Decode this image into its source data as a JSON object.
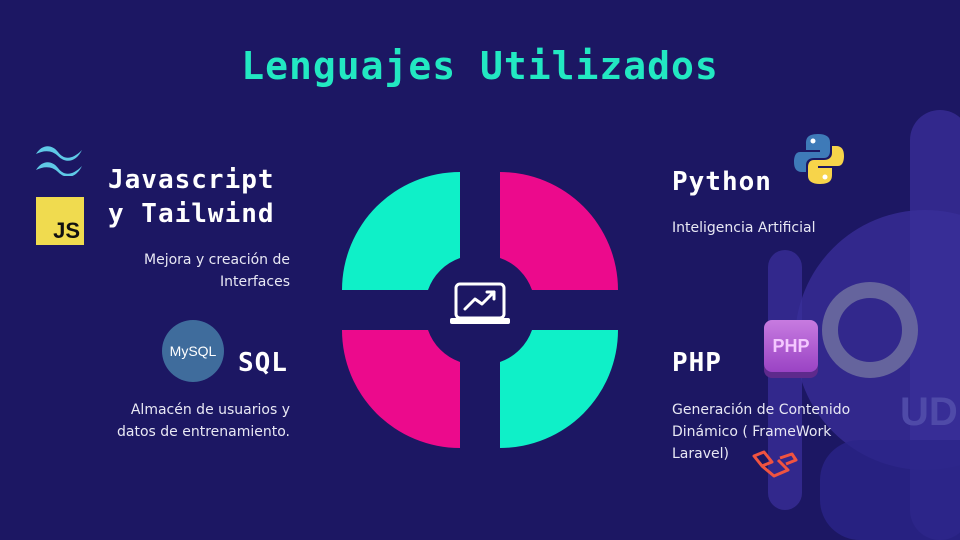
{
  "title": "Lenguajes Utilizados",
  "sections": {
    "js": {
      "heading_line1": "Javascript",
      "heading_line2": "y Tailwind",
      "desc_line1": "Mejora  y creación de",
      "desc_line2": "Interfaces",
      "logo_text": "JS"
    },
    "python": {
      "heading": "Python",
      "desc": "Inteligencia Artificial"
    },
    "sql": {
      "heading": "SQL",
      "desc_line1": "Almacén de usuarios y",
      "desc_line2": "datos de entrenamiento.",
      "logo_text": "MySQL"
    },
    "php": {
      "heading": "PHP",
      "desc_line1": "Generación de Contenido",
      "desc_line2": "Dinámico ( FrameWork",
      "desc_line3": "Laravel)",
      "logo_text": "PHP"
    }
  },
  "colors": {
    "background": "#1c1763",
    "title": "#22e8c2",
    "teal_quadrant": "#0ff0c8",
    "pink_quadrant": "#ec0a8c",
    "center_circle": "#1c1763"
  },
  "icons": {
    "center": "laptop-chart-icon",
    "tailwind": "tailwind-logo-icon",
    "python": "python-logo-icon",
    "laravel": "laravel-logo-icon"
  }
}
